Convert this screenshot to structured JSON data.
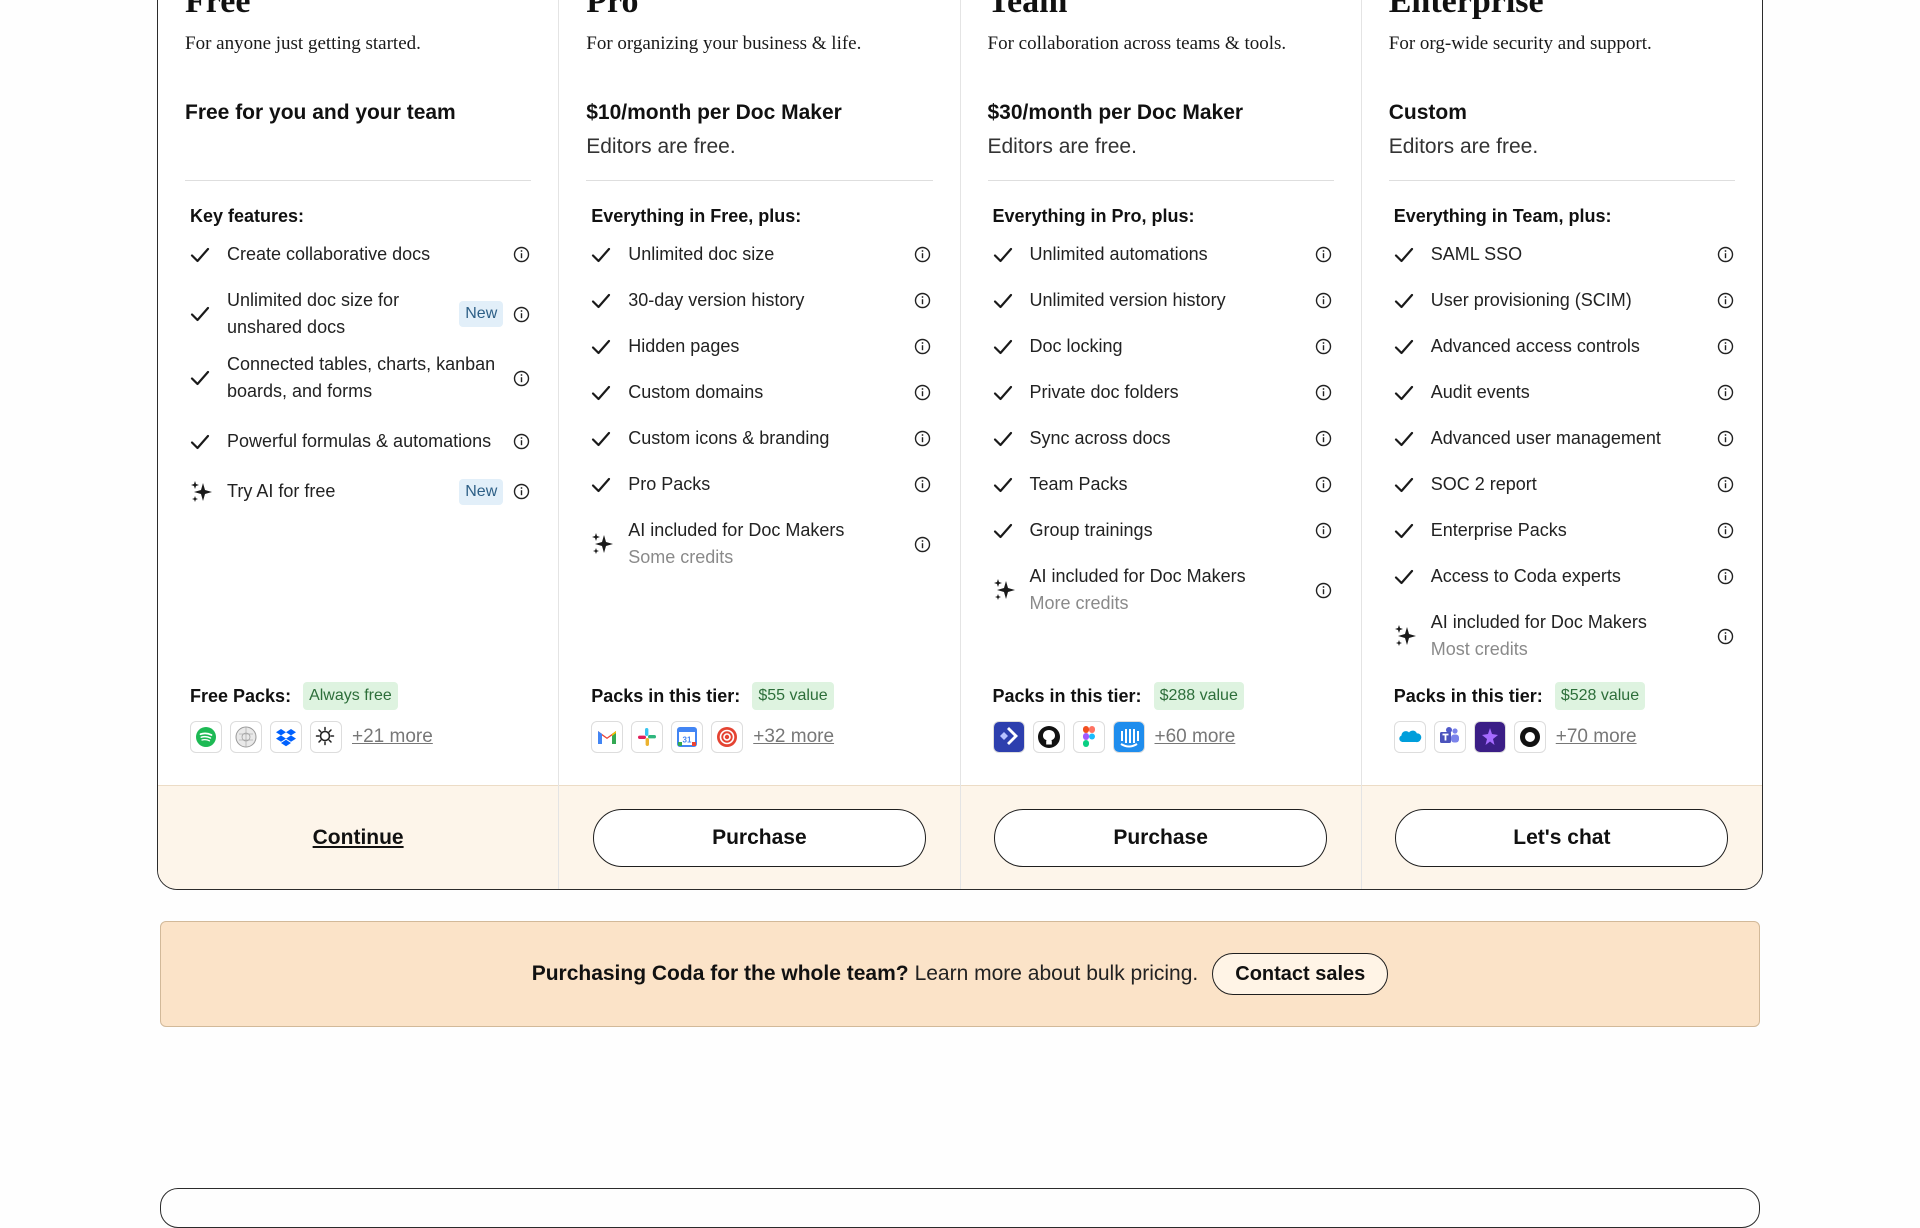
{
  "tiers": [
    {
      "name": "Free",
      "subtitle": "For anyone just getting started.",
      "price": "Free for you and your team",
      "editors": "",
      "features_title": "Key features:",
      "features": [
        {
          "text": "Create collaborative docs",
          "icon": "check"
        },
        {
          "text": "Unlimited doc size for unshared docs",
          "icon": "check",
          "badge": "New"
        },
        {
          "text": "Connected tables, charts, kanban boards, and forms",
          "icon": "check"
        },
        {
          "text": "Powerful formulas & automations",
          "icon": "check"
        },
        {
          "text": "Try AI for free",
          "icon": "sparkle",
          "badge": "New"
        }
      ],
      "packs_label": "Free Packs:",
      "packs_value": "Always free",
      "pack_icons": [
        "spotify",
        "wikipedia",
        "dropbox",
        "openweather"
      ],
      "more": "+21 more",
      "cta": "Continue",
      "cta_style": "link"
    },
    {
      "name": "Pro",
      "subtitle": "For organizing your business & life.",
      "price": "$10/month per Doc Maker",
      "editors": "Editors are free.",
      "features_title": "Everything in Free, plus:",
      "features": [
        {
          "text": "Unlimited doc size",
          "icon": "check"
        },
        {
          "text": "30-day version history",
          "icon": "check"
        },
        {
          "text": "Hidden pages",
          "icon": "check"
        },
        {
          "text": "Custom domains",
          "icon": "check"
        },
        {
          "text": "Custom icons & branding",
          "icon": "check"
        },
        {
          "text": "Pro Packs",
          "icon": "check"
        },
        {
          "text": "AI included for Doc Makers",
          "icon": "sparkle",
          "note": "Some credits"
        }
      ],
      "packs_label": "Packs in this tier:",
      "packs_value": "$55 value",
      "pack_icons": [
        "gmail",
        "slack",
        "google-calendar",
        "todoist"
      ],
      "more": "+32 more",
      "cta": "Purchase",
      "cta_style": "button"
    },
    {
      "name": "Team",
      "subtitle": "For collaboration across teams & tools.",
      "price": "$30/month per Doc Maker",
      "editors": "Editors are free.",
      "features_title": "Everything in Pro, plus:",
      "features": [
        {
          "text": "Unlimited automations",
          "icon": "check"
        },
        {
          "text": "Unlimited version history",
          "icon": "check"
        },
        {
          "text": "Doc locking",
          "icon": "check"
        },
        {
          "text": "Private doc folders",
          "icon": "check"
        },
        {
          "text": "Sync across docs",
          "icon": "check"
        },
        {
          "text": "Team Packs",
          "icon": "check"
        },
        {
          "text": "Group trainings",
          "icon": "check"
        },
        {
          "text": "AI included for Doc Makers",
          "icon": "sparkle",
          "note": "More credits"
        }
      ],
      "packs_label": "Packs in this tier:",
      "packs_value": "$288 value",
      "pack_icons": [
        "jira",
        "github",
        "figma",
        "intercom"
      ],
      "more": "+60 more",
      "cta": "Purchase",
      "cta_style": "button"
    },
    {
      "name": "Enterprise",
      "subtitle": "For org-wide security and support.",
      "price": "Custom",
      "editors": "Editors are free.",
      "features_title": "Everything in Team, plus:",
      "features": [
        {
          "text": "SAML SSO",
          "icon": "check"
        },
        {
          "text": "User provisioning (SCIM)",
          "icon": "check"
        },
        {
          "text": "Advanced access controls",
          "icon": "check"
        },
        {
          "text": "Audit events",
          "icon": "check"
        },
        {
          "text": "Advanced user management",
          "icon": "check"
        },
        {
          "text": "SOC 2 report",
          "icon": "check"
        },
        {
          "text": "Enterprise Packs",
          "icon": "check"
        },
        {
          "text": "Access to Coda experts",
          "icon": "check"
        },
        {
          "text": "AI included for Doc Makers",
          "icon": "sparkle",
          "note": "Most credits"
        }
      ],
      "packs_label": "Packs in this tier:",
      "packs_value": "$528 value",
      "pack_icons": [
        "salesforce",
        "microsoft-teams",
        "nebula",
        "ring"
      ],
      "more": "+70 more",
      "cta": "Let's chat",
      "cta_style": "button"
    }
  ],
  "banner": {
    "strong": "Purchasing Coda for the whole team?",
    "normal": "Learn more about bulk pricing.",
    "button": "Contact sales"
  }
}
